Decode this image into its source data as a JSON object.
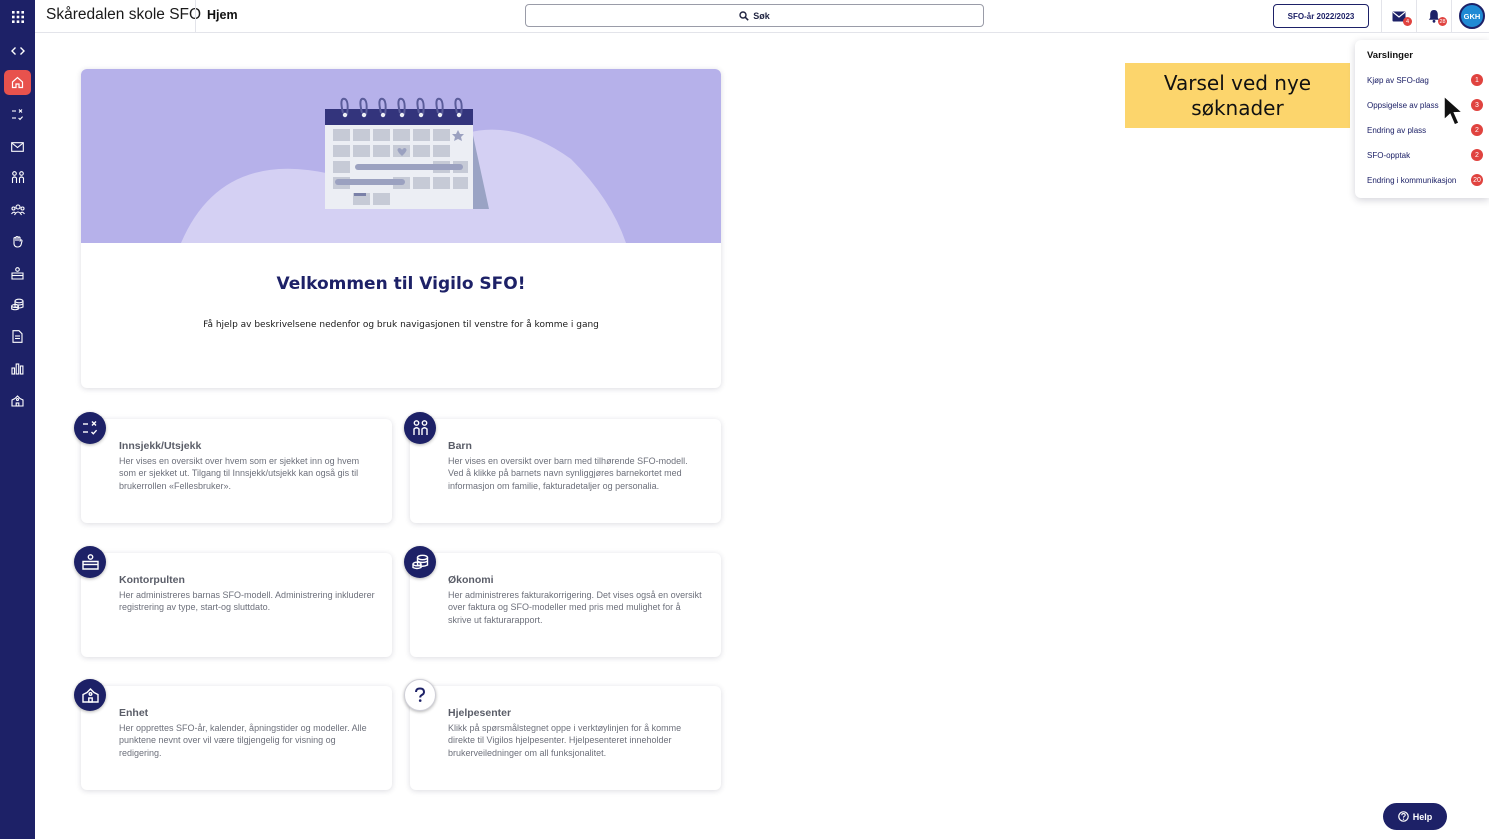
{
  "header": {
    "app_title": "Skåredalen skole SFO",
    "crumb": "Hjem",
    "search_label": "Søk",
    "year_button": "SFO-år 2022/2023",
    "mail_badge": "4",
    "bell_badge": "28",
    "avatar_initials": "GKH"
  },
  "notifications": {
    "title": "Varslinger",
    "items": [
      {
        "label": "Kjøp av SFO-dag",
        "count": "1"
      },
      {
        "label": "Oppsigelse av plass",
        "count": "3"
      },
      {
        "label": "Endring av plass",
        "count": "2"
      },
      {
        "label": "SFO-opptak",
        "count": "2"
      },
      {
        "label": "Endring i kommunikasjon",
        "count": "20"
      }
    ]
  },
  "annotation": {
    "line1": "Varsel ved nye",
    "line2": "søknader"
  },
  "welcome": {
    "title": "Velkommen til Vigilo SFO!",
    "subtitle": "Få hjelp av beskrivelsene nedenfor og bruk navigasjonen til venstre for å komme i gang"
  },
  "cards": [
    {
      "title": "Innsjekk/Utsjekk",
      "icon": "check-in-icon",
      "text": "Her vises en oversikt over hvem som er sjekket inn og hvem som er sjekket ut. Tilgang til Innsjekk/utsjekk kan også gis til brukerrollen «Fellesbruker»."
    },
    {
      "title": "Barn",
      "icon": "children-icon",
      "text": "Her vises en oversikt over barn med tilhørende SFO-modell. Ved å klikke på barnets navn synliggjøres barnekortet med informasjon om familie, fakturadetaljer og personalia."
    },
    {
      "title": "Kontorpulten",
      "icon": "desk-icon",
      "text": "Her administreres barnas SFO-modell. Administrering inkluderer registrering av type, start-og sluttdato."
    },
    {
      "title": "Økonomi",
      "icon": "coins-icon",
      "text": "Her administreres fakturakorrigering. Det vises også en oversikt over faktura og SFO-modeller med pris med mulighet for å skrive ut fakturarapport."
    },
    {
      "title": "Enhet",
      "icon": "school-icon",
      "text": "Her opprettes SFO-år, kalender, åpningstider og modeller. Alle punktene nevnt over vil være tilgjengelig for visning og redigering."
    },
    {
      "title": "Hjelpesenter",
      "icon": "question-icon",
      "text": "Klikk på spørsmålstegnet oppe i verktøylinjen for å komme direkte til Vigilos hjelpesenter. Hjelpesenteret inneholder brukerveiledninger om all funksjonalitet."
    }
  ],
  "help_button": "Help",
  "colors": {
    "navy": "#1d2167",
    "accent_red": "#e8524d",
    "banner_purple": "#b6b1ea",
    "callout_yellow": "#fcd56c"
  }
}
